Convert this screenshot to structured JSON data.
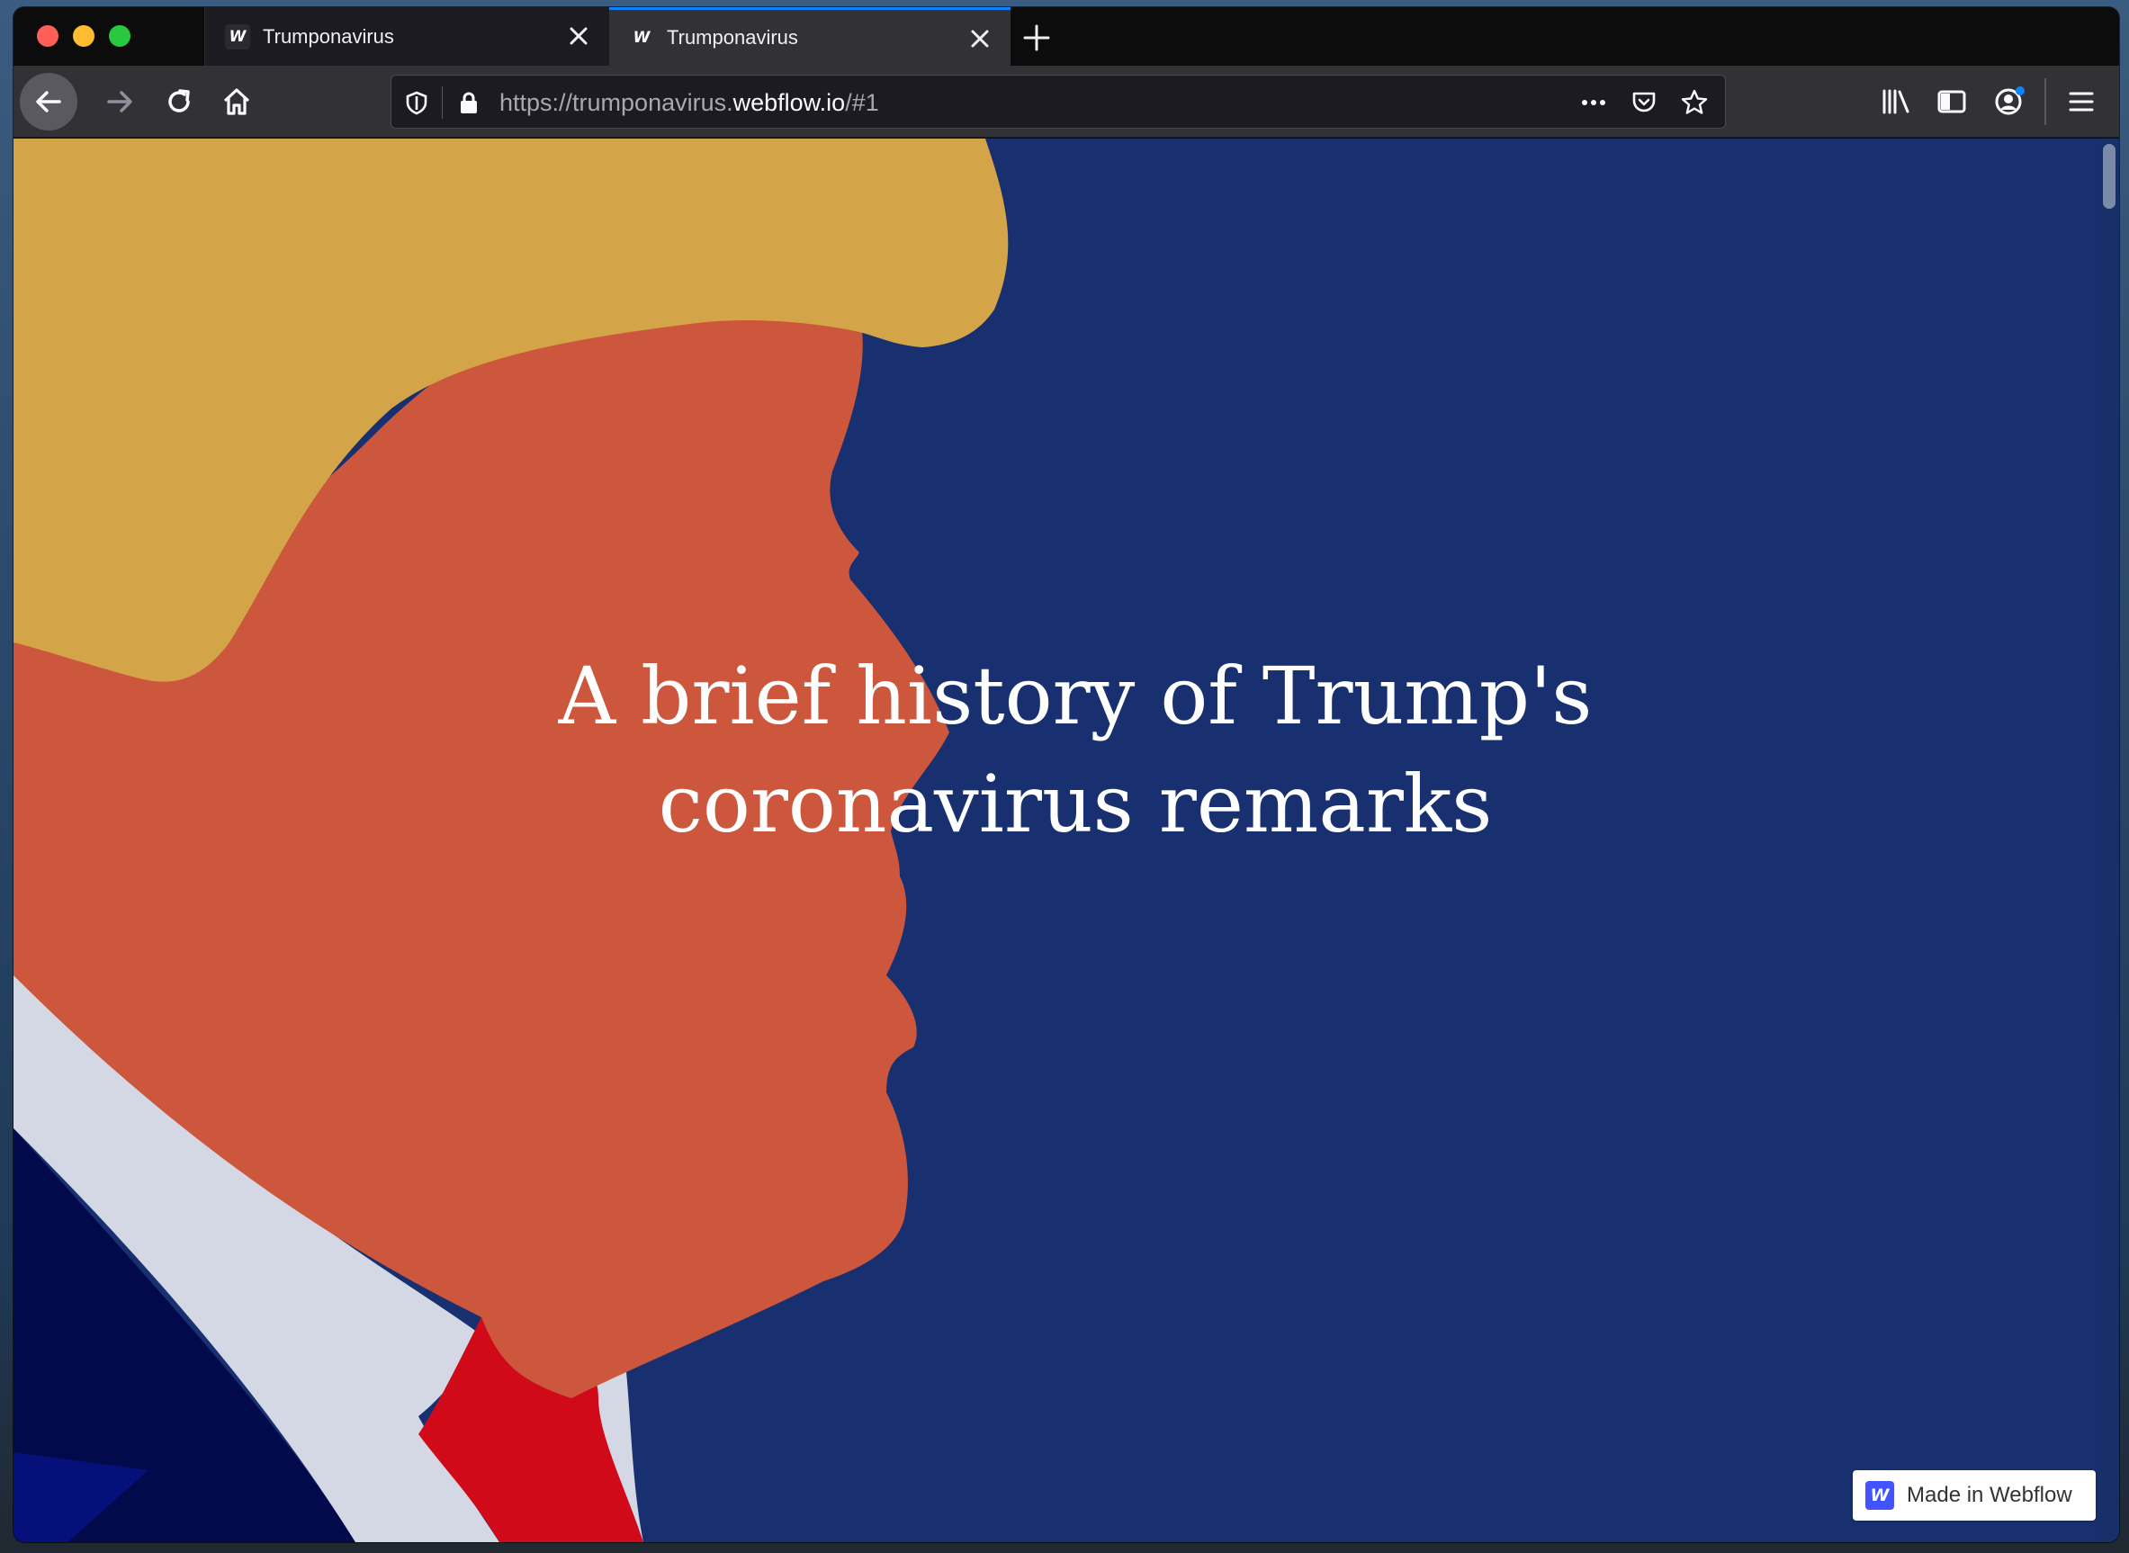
{
  "browser": {
    "tabs": [
      {
        "title": "Trumponavirus",
        "favicon": "W",
        "active": false
      },
      {
        "title": "Trumponavirus",
        "favicon": "W",
        "active": true
      }
    ],
    "url": {
      "prefix": "https://trumponavirus.",
      "domain": "webflow.io",
      "suffix": "/#1"
    }
  },
  "page": {
    "headline_line1": "A brief history of Trump's",
    "headline_line2": "coronavirus remarks"
  },
  "badge": {
    "logo": "W",
    "text": "Made in Webflow"
  },
  "colors": {
    "background": "#183070",
    "hair": "#d3a548",
    "face": "#cd573d",
    "shirt": "#d3d8e4",
    "suit": "#030a4c",
    "tie": "#d10a19",
    "tab_accent": "#0a84ff",
    "webflow_blue": "#4353ff"
  }
}
